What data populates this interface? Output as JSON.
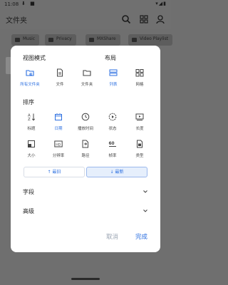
{
  "status": {
    "time": "11:08"
  },
  "app": {
    "title": "文件夹"
  },
  "chips": [
    "Music",
    "Privacy",
    "MXShare",
    "Video Playlist"
  ],
  "dialog": {
    "view_mode_title": "视图模式",
    "layout_title": "布局",
    "view_modes": [
      {
        "label": "所有文件夹",
        "selected": true
      },
      {
        "label": "文件",
        "selected": false
      },
      {
        "label": "文件夹",
        "selected": false
      }
    ],
    "layouts": [
      {
        "label": "列表",
        "selected": true
      },
      {
        "label": "网格",
        "selected": false
      }
    ],
    "sort_title": "排序",
    "sort_row1": [
      {
        "label": "标题",
        "selected": false
      },
      {
        "label": "日期",
        "selected": true
      },
      {
        "label": "播放时间",
        "selected": false
      },
      {
        "label": "状态",
        "selected": false
      },
      {
        "label": "长度",
        "selected": false
      }
    ],
    "sort_row2": [
      {
        "label": "大小",
        "selected": false
      },
      {
        "label": "分辨率",
        "selected": false
      },
      {
        "label": "路径",
        "selected": false
      },
      {
        "label": "帧率",
        "selected": false
      },
      {
        "label": "类型",
        "selected": false
      }
    ],
    "order_old": "最旧",
    "order_new": "最新",
    "fields_label": "字段",
    "advanced_label": "高级",
    "cancel_label": "取消",
    "done_label": "完成"
  },
  "colors": {
    "accent": "#2c6fe0",
    "selected_bg": "#e6effc"
  }
}
